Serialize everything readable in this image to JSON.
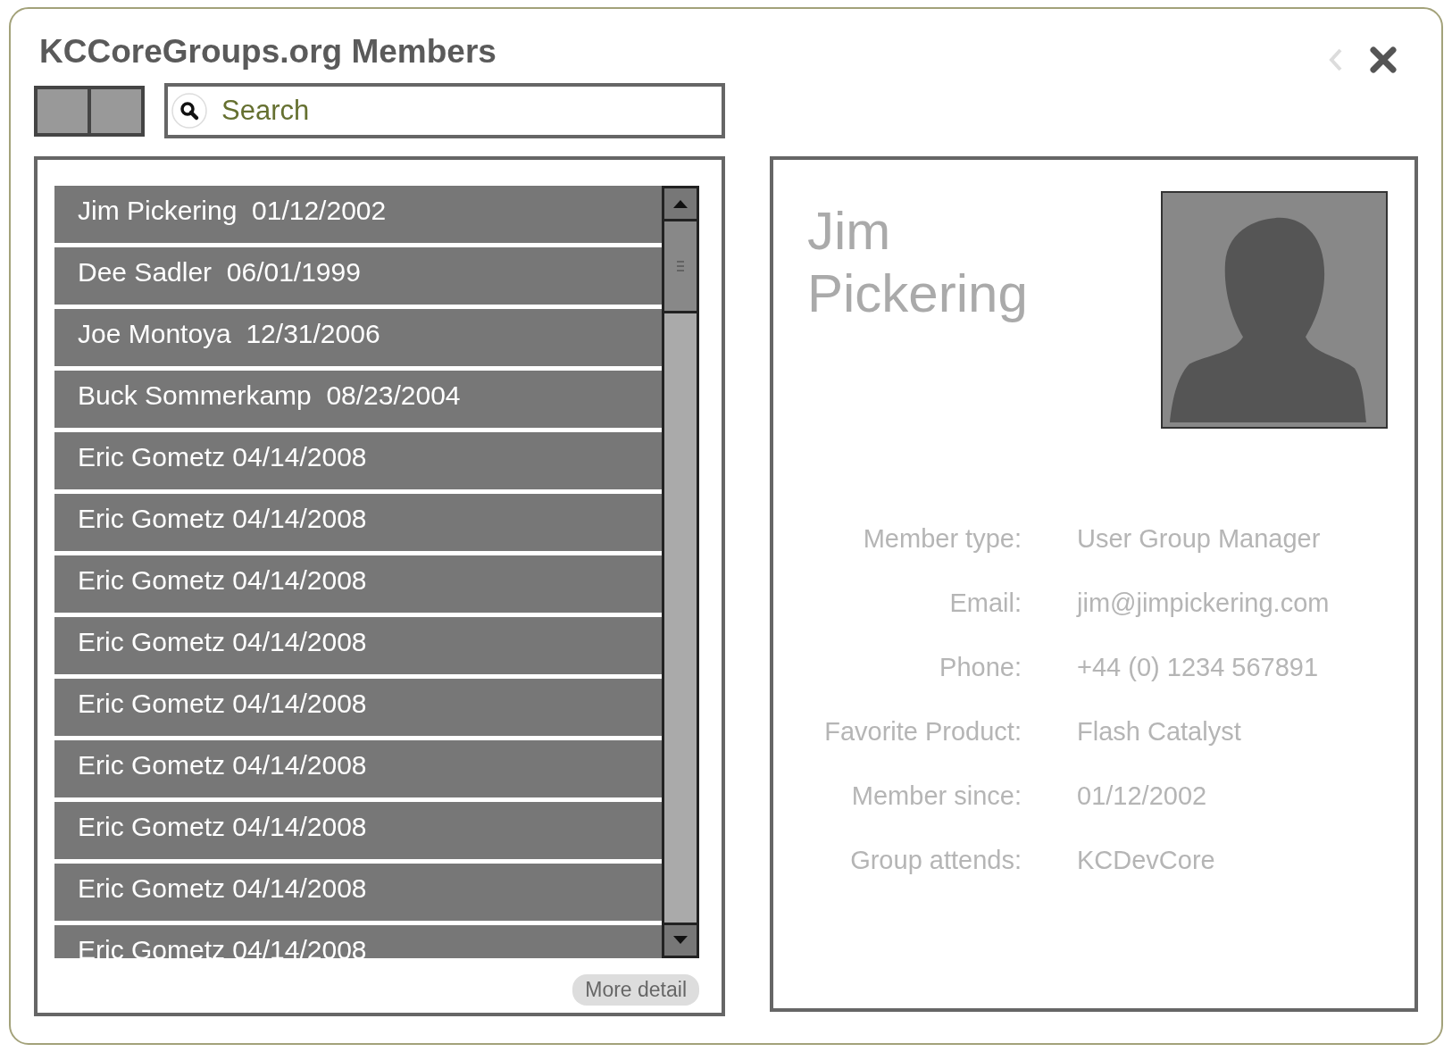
{
  "window": {
    "title": "KCCoreGroups.org Members"
  },
  "search": {
    "placeholder": "Search"
  },
  "members": [
    {
      "label": "Jim Pickering  01/12/2002"
    },
    {
      "label": "Dee Sadler  06/01/1999"
    },
    {
      "label": "Joe Montoya  12/31/2006"
    },
    {
      "label": "Buck Sommerkamp  08/23/2004"
    },
    {
      "label": "Eric Gometz 04/14/2008"
    },
    {
      "label": "Eric Gometz 04/14/2008"
    },
    {
      "label": "Eric Gometz 04/14/2008"
    },
    {
      "label": "Eric Gometz 04/14/2008"
    },
    {
      "label": "Eric Gometz 04/14/2008"
    },
    {
      "label": "Eric Gometz 04/14/2008"
    },
    {
      "label": "Eric Gometz 04/14/2008"
    },
    {
      "label": "Eric Gometz 04/14/2008"
    },
    {
      "label": "Eric Gometz 04/14/2008"
    }
  ],
  "more_button": "More detail",
  "detail": {
    "name": "Jim Pickering",
    "fields": [
      {
        "label": "Member type:",
        "value": "User Group Manager"
      },
      {
        "label": "Email:",
        "value": "jim@jimpickering.com"
      },
      {
        "label": "Phone:",
        "value": "+44 (0) 1234 567891"
      },
      {
        "label": "Favorite Product:",
        "value": "Flash Catalyst"
      },
      {
        "label": "Member since:",
        "value": "01/12/2002"
      },
      {
        "label": "Group attends:",
        "value": "KCDevCore"
      }
    ]
  }
}
